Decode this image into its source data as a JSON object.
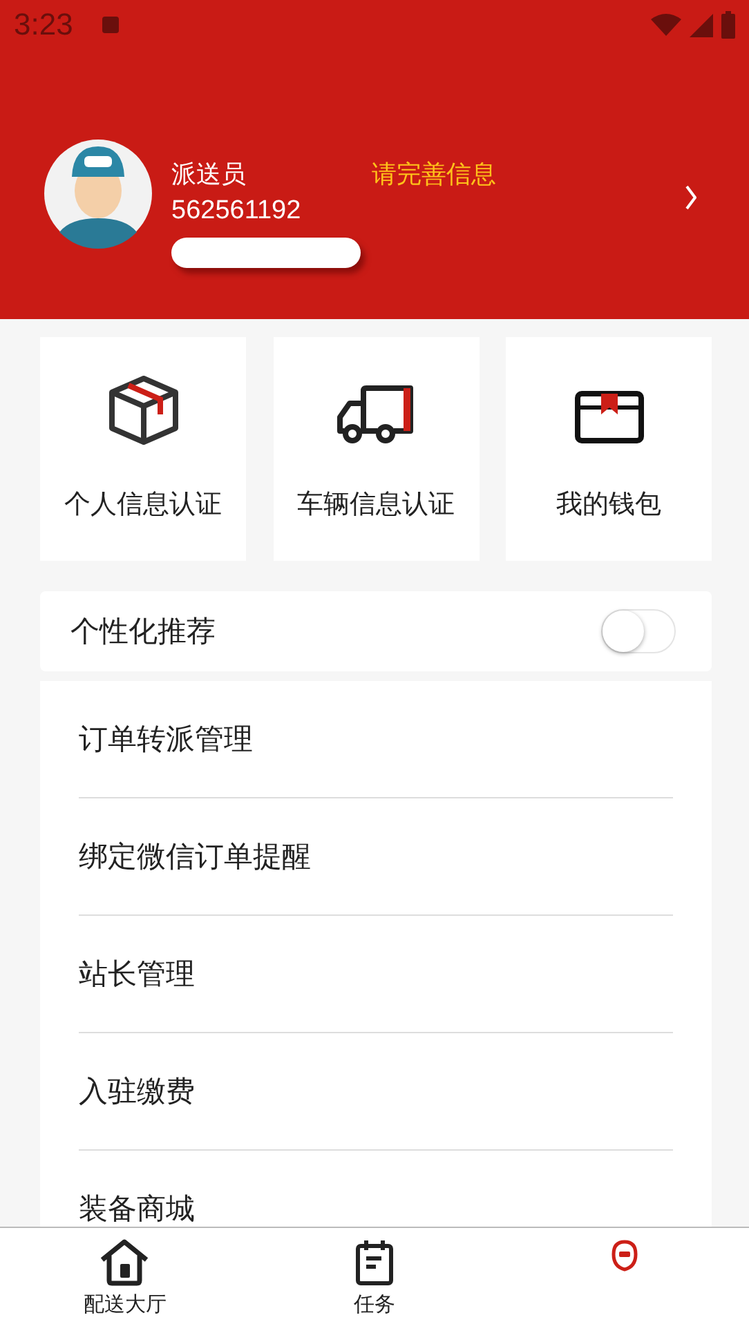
{
  "status_bar": {
    "time": "3:23"
  },
  "profile": {
    "role": "派送员",
    "account": "562561192",
    "prompt": "请完善信息"
  },
  "shortcuts": [
    {
      "kind": "box",
      "label": "个人信息认证"
    },
    {
      "kind": "truck",
      "label": "车辆信息认证"
    },
    {
      "kind": "wallet",
      "label": "我的钱包"
    }
  ],
  "recommend": {
    "label": "个性化推荐",
    "on": false
  },
  "menu": [
    "订单转派管理",
    "绑定微信订单提醒",
    "站长管理",
    "入驻缴费",
    "装备商城"
  ],
  "nav": [
    {
      "kind": "home",
      "label": "配送大厅",
      "selected": false
    },
    {
      "kind": "task",
      "label": "任务",
      "selected": false
    },
    {
      "kind": "me",
      "selected": true
    }
  ]
}
